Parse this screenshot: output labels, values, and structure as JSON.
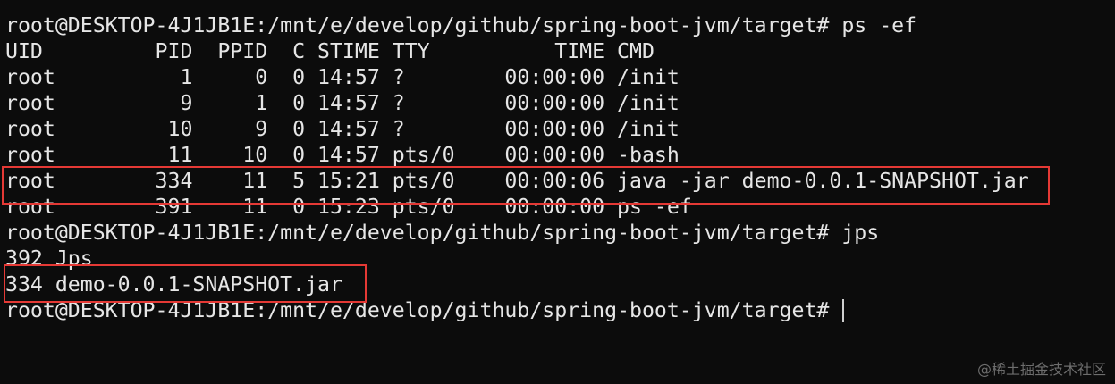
{
  "terminal": {
    "lines": [
      "root@DESKTOP-4J1JB1E:/mnt/e/develop/github/spring-boot-jvm/target# ps -ef",
      "UID         PID  PPID  C STIME TTY          TIME CMD",
      "root          1     0  0 14:57 ?        00:00:00 /init",
      "root          9     1  0 14:57 ?        00:00:00 /init",
      "root         10     9  0 14:57 ?        00:00:00 /init",
      "root         11    10  0 14:57 pts/0    00:00:00 -bash",
      "root        334    11  5 15:21 pts/0    00:00:06 java -jar demo-0.0.1-SNAPSHOT.jar",
      "root        391    11  0 15:23 pts/0    00:00:00 ps -ef",
      "root@DESKTOP-4J1JB1E:/mnt/e/develop/github/spring-boot-jvm/target# jps",
      "392 Jps",
      "334 demo-0.0.1-SNAPSHOT.jar",
      "root@DESKTOP-4J1JB1E:/mnt/e/develop/github/spring-boot-jvm/target# "
    ]
  },
  "watermark": "@稀土掘金技术社区",
  "colors": {
    "background": "#0c0c0c",
    "text": "#e6e6e6",
    "highlight_border": "#e53935",
    "watermark": "#6d6d6d"
  }
}
